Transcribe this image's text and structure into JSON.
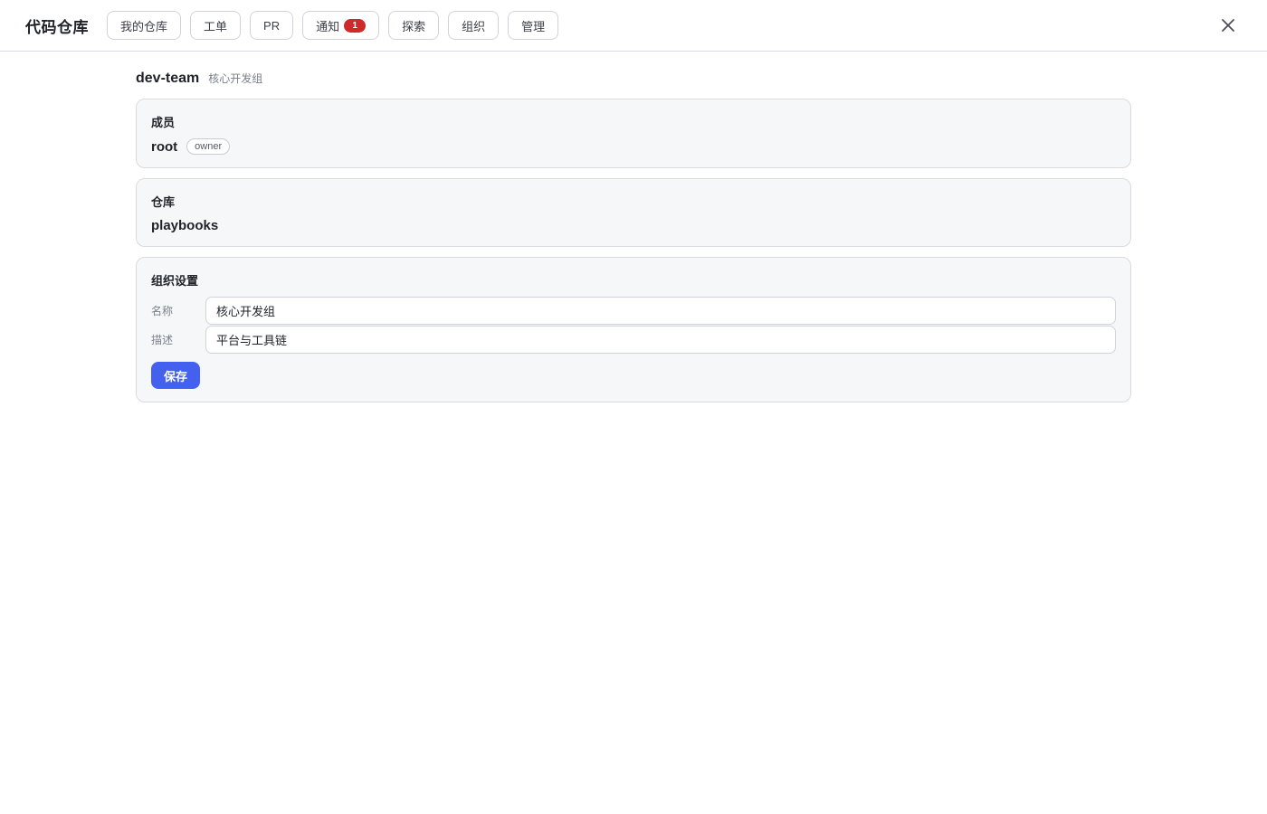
{
  "app": {
    "title": "代码仓库"
  },
  "nav": {
    "my_repos": "我的仓库",
    "issues": "工单",
    "pr": "PR",
    "notifications": "通知",
    "notification_count": "1",
    "explore": "探索",
    "orgs": "组织",
    "admin": "管理"
  },
  "icons": {
    "close": "close-icon"
  },
  "org": {
    "name": "dev-team",
    "display_name": "核心开发组"
  },
  "members_section": {
    "title": "成员",
    "items": [
      {
        "name": "root",
        "role": "owner"
      }
    ]
  },
  "repos_section": {
    "title": "仓库",
    "items": [
      {
        "name": "playbooks"
      }
    ]
  },
  "settings_section": {
    "title": "组织设置",
    "name_label": "名称",
    "name_value": "核心开发组",
    "desc_label": "描述",
    "desc_value": "平台与工具链",
    "save_label": "保存"
  },
  "colors": {
    "accent": "#4361ee",
    "badge": "#cf2a2a",
    "card_bg": "#f6f7f9",
    "border": "#d8dbe0"
  }
}
